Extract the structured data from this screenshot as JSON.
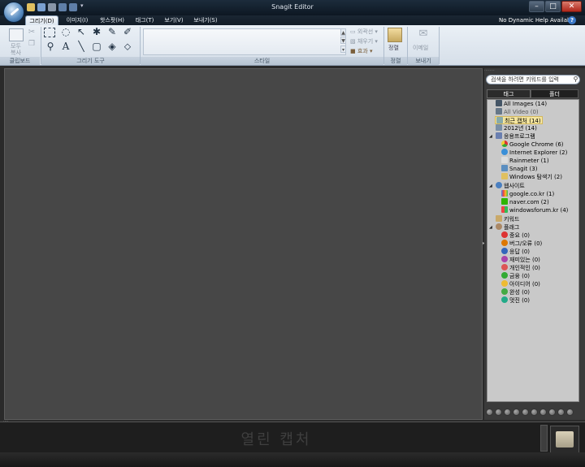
{
  "window": {
    "title": "Snagit Editor"
  },
  "tabs": [
    {
      "label": "그리기(D)",
      "active": true
    },
    {
      "label": "이미지(I)"
    },
    {
      "label": "핫스팟(H)"
    },
    {
      "label": "태그(T)"
    },
    {
      "label": "보기(V)"
    },
    {
      "label": "보내기(S)"
    }
  ],
  "help": {
    "text": "No Dynamic Help Available",
    "icon": "help-icon"
  },
  "ribbon": {
    "clipboard": {
      "label": "클립보드",
      "paste": "모두",
      "copy": "복사"
    },
    "drawing_tools": {
      "label": "그리기 도구"
    },
    "styles": {
      "label": "스타일",
      "outline": "외곽선",
      "fill": "채우기",
      "effects": "효과"
    },
    "arrange": {
      "label": "정렬",
      "group_label": "정렬"
    },
    "send": {
      "label": "이메일",
      "group_label": "보내기"
    }
  },
  "search": {
    "placeholder": "검색을 하려면 키워드를 입력"
  },
  "panel_tabs": {
    "tags": "태그",
    "folders": "폴더"
  },
  "tree": {
    "all_images": "All Images (14)",
    "all_video": "All Video (0)",
    "recent": "최근 캡처 (14)",
    "year": "2012년 (14)",
    "apps": "응용프로그램",
    "app_items": [
      "Google Chrome (6)",
      "Internet Explorer (2)",
      "Rainmeter (1)",
      "Snagit (3)",
      "Windows 탐색기 (2)"
    ],
    "websites": "웹사이트",
    "site_items": [
      "google.co.kr (1)",
      "naver.com (2)",
      "windowsforum.kr (4)"
    ],
    "keywords": "키워드",
    "flags": "플래그",
    "flag_items": [
      "중요 (0)",
      "버그/오류 (0)",
      "응답 (0)",
      "재미있는 (0)",
      "개인적인 (0)",
      "금융 (0)",
      "아이디어 (0)",
      "완성 (0)",
      "멋진 (0)"
    ]
  },
  "tray": {
    "empty_text": "열린 캡처"
  },
  "colors": {
    "canvas": "#474747",
    "panel": "#c9c9c9",
    "highlight": "#f5e6a0"
  }
}
